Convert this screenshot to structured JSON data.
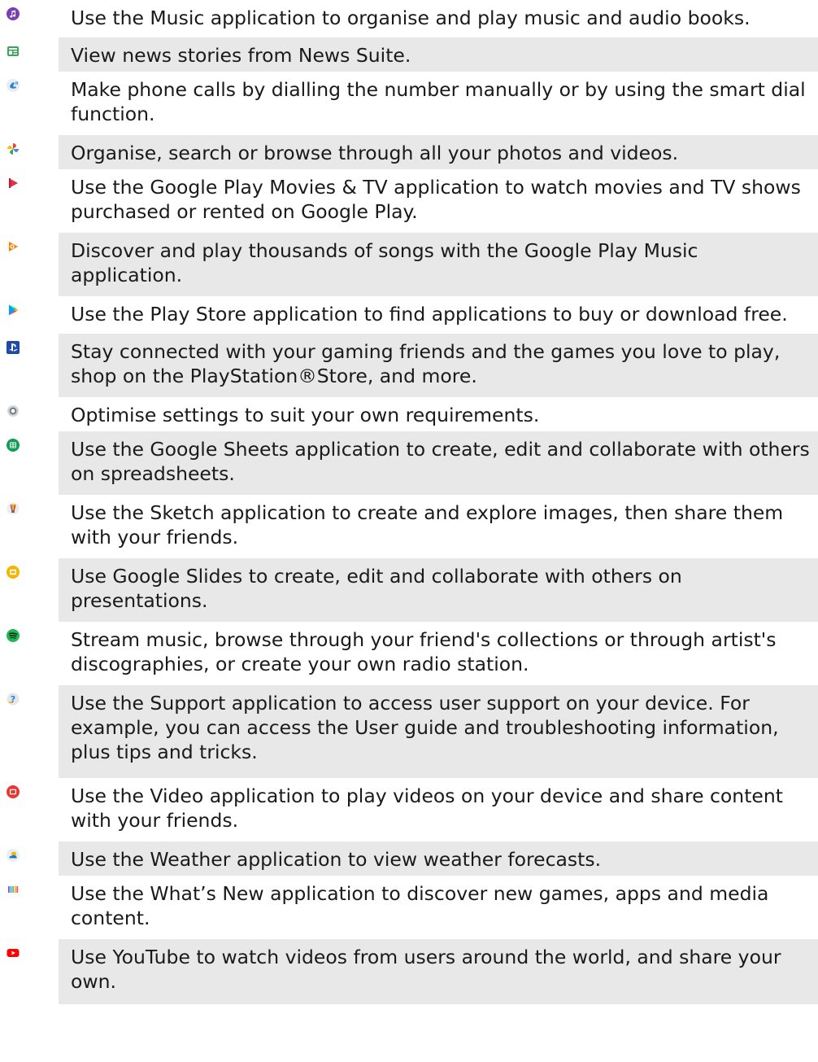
{
  "apps": [
    {
      "icon": "music-icon",
      "description": "Use the Music application to organise and play music and audio books."
    },
    {
      "icon": "news-suite-icon",
      "description": "View news stories from News Suite."
    },
    {
      "icon": "phone-icon",
      "description": "Make phone calls by dialling the number manually or by using the smart dial function."
    },
    {
      "icon": "google-photos-icon",
      "description": "Organise, search or browse through all your photos and videos."
    },
    {
      "icon": "play-movies-icon",
      "description": "Use the Google Play Movies & TV application to watch movies and TV shows purchased or rented on Google Play."
    },
    {
      "icon": "play-music-icon",
      "description": "Discover and play thousands of songs with the Google Play Music application."
    },
    {
      "icon": "play-store-icon",
      "description": "Use the Play Store application to find applications to buy or download free."
    },
    {
      "icon": "playstation-icon",
      "description": "Stay connected with your gaming friends and the games you love to play, shop on the PlayStation®Store, and more."
    },
    {
      "icon": "settings-icon",
      "description": "Optimise settings to suit your own requirements."
    },
    {
      "icon": "google-sheets-icon",
      "description": "Use the Google Sheets application to create, edit and collaborate with others on spreadsheets."
    },
    {
      "icon": "sketch-icon",
      "description": "Use the Sketch application to create and explore images, then share them with your friends."
    },
    {
      "icon": "google-slides-icon",
      "description": "Use Google Slides to create, edit and collaborate with others on presentations."
    },
    {
      "icon": "spotify-icon",
      "description": "Stream music, browse through your friend's collections or through artist's discographies, or create your own radio station."
    },
    {
      "icon": "support-icon",
      "description": "Use the Support application to access user support on your device. For example, you can access the User guide and troubleshooting information, plus tips and tricks."
    },
    {
      "icon": "video-icon",
      "description": "Use the Video application to play videos on your device and share content with your friends."
    },
    {
      "icon": "weather-icon",
      "description": "Use the Weather application to view weather forecasts."
    },
    {
      "icon": "whats-new-icon",
      "description": "Use the What’s New application to discover new games, apps and media content."
    },
    {
      "icon": "youtube-icon",
      "description": "Use YouTube to watch videos from users around the world, and share your own."
    }
  ],
  "colors": {
    "row_shade": "#e8e8e8",
    "text": "#1a1a1a"
  }
}
